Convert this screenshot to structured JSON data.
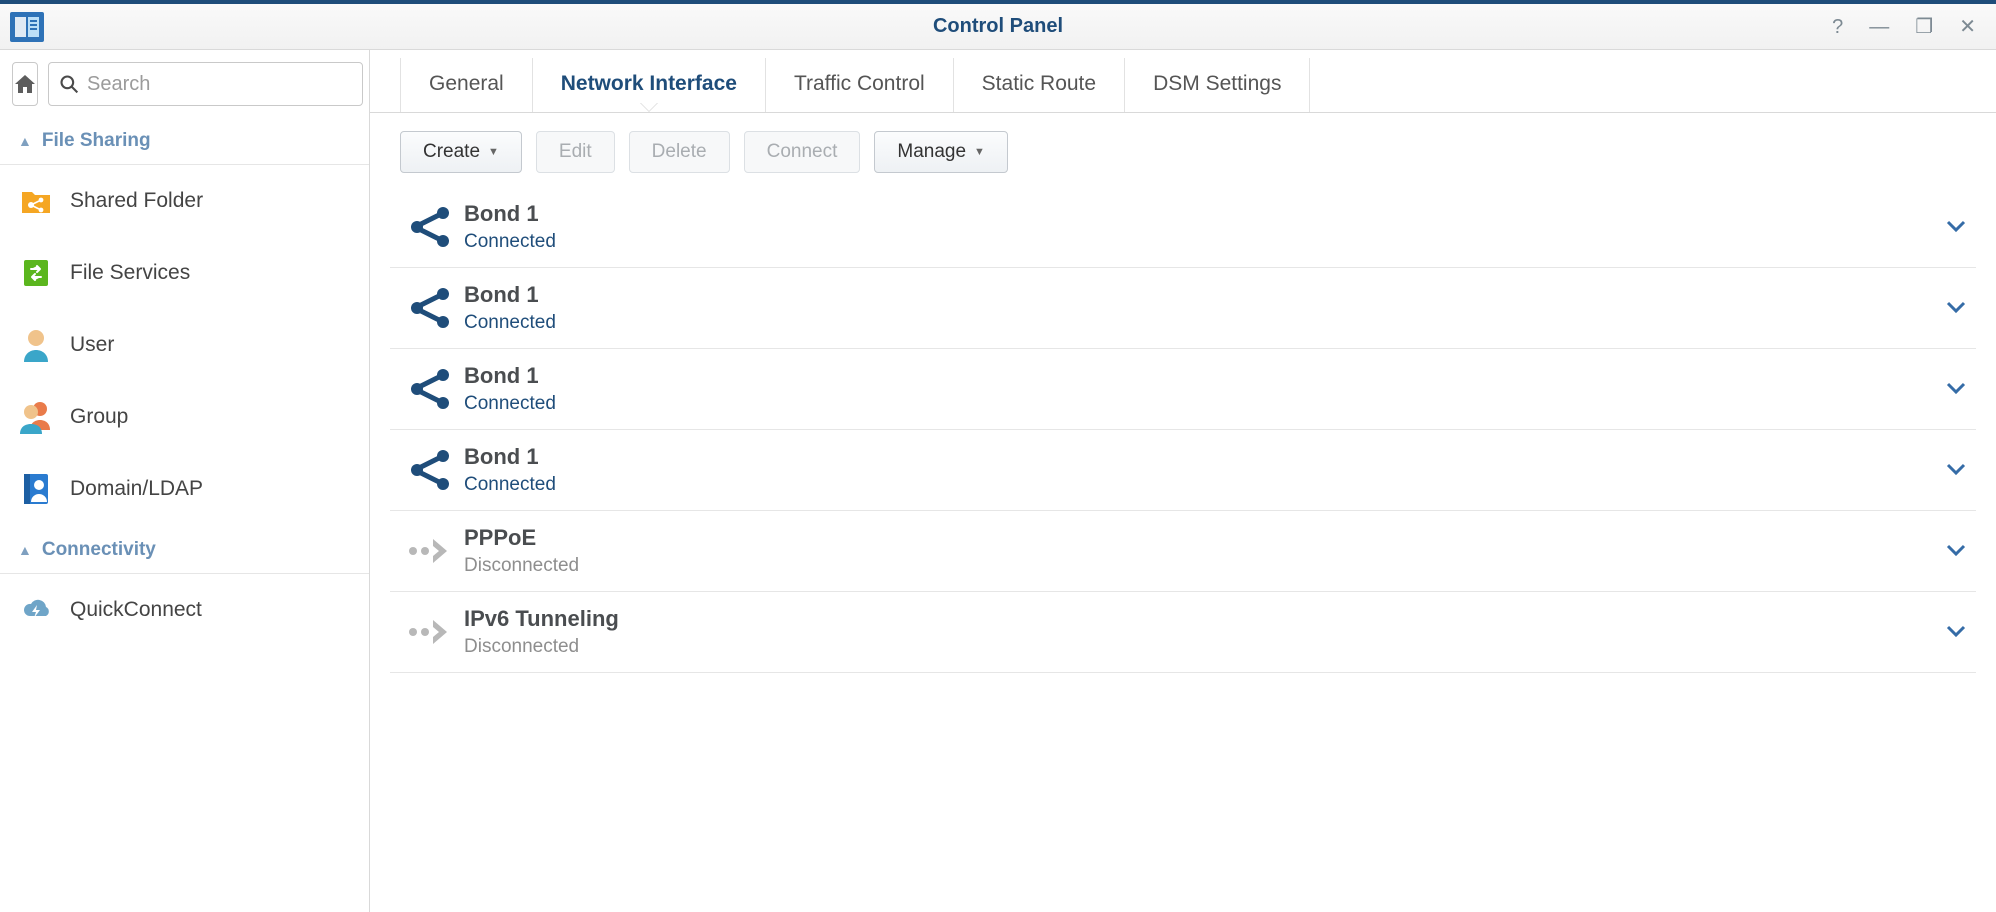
{
  "window": {
    "title": "Control Panel"
  },
  "search": {
    "placeholder": "Search"
  },
  "sidebar": {
    "sections": [
      {
        "label": "File Sharing",
        "items": [
          {
            "label": "Shared Folder",
            "icon": "folder-share",
            "color": "#f5a623"
          },
          {
            "label": "File Services",
            "icon": "file-sync",
            "color": "#5bb61e"
          },
          {
            "label": "User",
            "icon": "user",
            "color": "#f0c38b"
          },
          {
            "label": "Group",
            "icon": "group",
            "color": "#f0c38b"
          },
          {
            "label": "Domain/LDAP",
            "icon": "domain",
            "color": "#2a7bd0"
          }
        ]
      },
      {
        "label": "Connectivity",
        "items": [
          {
            "label": "QuickConnect",
            "icon": "cloud-bolt",
            "color": "#6fa5c8"
          }
        ]
      }
    ]
  },
  "tabs": [
    {
      "label": "General",
      "active": false
    },
    {
      "label": "Network Interface",
      "active": true
    },
    {
      "label": "Traffic Control",
      "active": false
    },
    {
      "label": "Static Route",
      "active": false
    },
    {
      "label": "DSM Settings",
      "active": false
    }
  ],
  "toolbar": {
    "create": {
      "label": "Create",
      "enabled": true,
      "dropdown": true
    },
    "edit": {
      "label": "Edit",
      "enabled": false,
      "dropdown": false
    },
    "delete": {
      "label": "Delete",
      "enabled": false,
      "dropdown": false
    },
    "connect": {
      "label": "Connect",
      "enabled": false,
      "dropdown": false
    },
    "manage": {
      "label": "Manage",
      "enabled": true,
      "dropdown": true
    }
  },
  "interfaces": [
    {
      "name": "Bond 1",
      "status": "Connected",
      "status_kind": "connected",
      "icon": "bond"
    },
    {
      "name": "Bond 1",
      "status": "Connected",
      "status_kind": "connected",
      "icon": "bond"
    },
    {
      "name": "Bond 1",
      "status": "Connected",
      "status_kind": "connected",
      "icon": "bond"
    },
    {
      "name": "Bond 1",
      "status": "Connected",
      "status_kind": "connected",
      "icon": "bond"
    },
    {
      "name": "PPPoE",
      "status": "Disconnected",
      "status_kind": "disconnected",
      "icon": "tunnel"
    },
    {
      "name": "IPv6 Tunneling",
      "status": "Disconnected",
      "status_kind": "disconnected",
      "icon": "tunnel"
    }
  ]
}
